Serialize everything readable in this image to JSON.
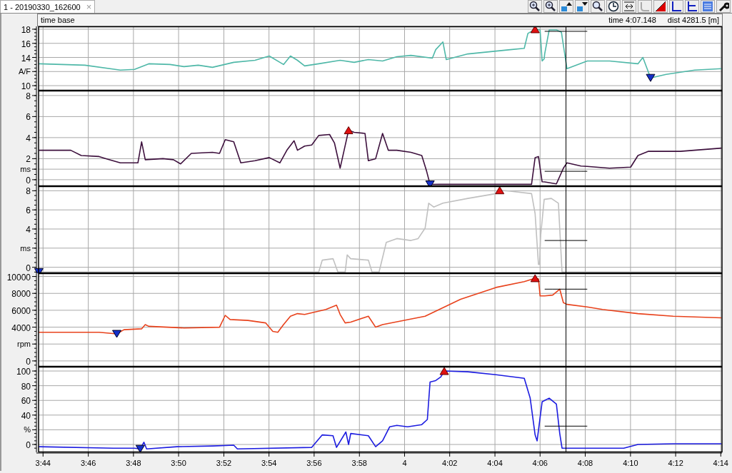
{
  "tab": {
    "label": "1 - 20190330_162600",
    "close": "×",
    "selected": true
  },
  "header": {
    "label": "time base",
    "time": "time 4:07.148",
    "dist": "dist 4281.5 [m]"
  },
  "charts": [
    {
      "chart_data": {
        "type": "line",
        "ylabel": "A/F",
        "xlim": [
          3.73,
          4.2342
        ],
        "ylim": [
          9.4,
          18.3
        ],
        "yticks": [
          10,
          14,
          16,
          18
        ],
        "grid": true,
        "x": [
          3.7302,
          3.7642,
          3.7903,
          3.8008,
          3.8113,
          3.827,
          3.8373,
          3.8478,
          3.8583,
          3.874,
          3.8897,
          3.9002,
          3.9107,
          3.9158,
          3.921,
          3.9263,
          3.9367,
          3.9525,
          3.9628,
          3.9733,
          3.9838,
          3.9943,
          4.0047,
          4.0205,
          4.023,
          4.0283,
          4.0308,
          4.0467,
          4.0623,
          4.078,
          4.0883,
          4.091,
          4.0963,
          4.1,
          4.1015,
          4.103,
          4.1034,
          4.1067,
          4.112,
          4.1157,
          4.1198,
          4.1348,
          4.1355,
          4.1512,
          4.1722,
          4.1758,
          4.1815,
          4.193,
          4.214,
          4.2338
        ],
        "series": [
          {
            "color": "#4fb8a8",
            "values": [
              13.1,
              12.9,
              12.2,
              12.3,
              13.1,
              13.0,
              12.7,
              12.9,
              12.6,
              13.3,
              13.6,
              14.2,
              13.0,
              14.2,
              13.6,
              12.8,
              13.1,
              13.6,
              13.3,
              13.7,
              13.5,
              14.1,
              14.3,
              13.9,
              15.1,
              16.2,
              13.7,
              14.5,
              14.8,
              15.1,
              15.3,
              17.4,
              18.0,
              17.9,
              13.5,
              13.8,
              14.5,
              17.9,
              17.9,
              17.6,
              12.4,
              13.5,
              13.5,
              13.5,
              13.1,
              14.0,
              11.1,
              11.6,
              12.2,
              12.4
            ]
          },
          {
            "color": "#000000",
            "values": [
              null,
              null,
              null,
              null,
              null,
              null,
              null,
              null,
              null,
              null,
              null,
              null,
              null,
              null,
              null,
              null,
              null,
              null,
              null,
              null,
              null,
              null,
              null,
              null,
              null,
              null,
              null,
              null,
              null,
              null,
              null,
              null,
              null,
              null,
              null,
              null,
              17.7,
              17.7,
              17.7,
              17.7,
              17.7,
              17.7,
              null,
              null,
              null,
              null,
              null,
              null,
              null,
              null
            ]
          }
        ],
        "ref_lines": [
          {
            "axis": "x",
            "value": 4.1191
          }
        ]
      }
    },
    {
      "chart_data": {
        "type": "line",
        "ylabel": "ms",
        "xlim": [
          3.73,
          4.2342
        ],
        "ylim": [
          -0.55,
          8.4
        ],
        "yticks": [
          0,
          2,
          4,
          6,
          8
        ],
        "grid": true,
        "x": [
          3.7302,
          3.7537,
          3.7615,
          3.7747,
          3.7798,
          3.7903,
          3.8033,
          3.806,
          3.8087,
          3.8217,
          3.8295,
          3.8348,
          3.8427,
          3.8583,
          3.8635,
          3.8677,
          3.874,
          3.8792,
          3.8897,
          3.9002,
          3.908,
          3.9132,
          3.9185,
          3.921,
          3.9263,
          3.9315,
          3.9367,
          3.9447,
          3.9483,
          3.9525,
          3.9587,
          3.9628,
          3.9708,
          3.9733,
          3.9787,
          3.9838,
          3.988,
          3.9943,
          4.0047,
          4.0127,
          4.0163,
          4.0188,
          4.0257,
          4.0675,
          4.0937,
          4.0963,
          4.0988,
          4.1015,
          4.1034,
          4.112,
          4.1172,
          4.1198,
          4.1302,
          4.1348,
          4.1512,
          4.1668,
          4.1722,
          4.18,
          4.2035,
          4.2338
        ],
        "series": [
          {
            "color": "#3d103d",
            "values": [
              2.8,
              2.8,
              2.3,
              2.2,
              2.0,
              1.6,
              1.6,
              3.6,
              1.9,
              2.0,
              1.9,
              1.5,
              2.5,
              2.6,
              2.5,
              3.8,
              3.6,
              1.6,
              1.8,
              2.1,
              1.6,
              2.8,
              3.7,
              2.8,
              3.2,
              3.3,
              4.2,
              4.3,
              3.5,
              1.1,
              4.7,
              4.5,
              4.4,
              1.8,
              2.0,
              4.4,
              2.8,
              2.8,
              2.6,
              2.3,
              0.8,
              -0.45,
              -0.44,
              -0.44,
              -0.44,
              2.1,
              2.2,
              -0.2,
              -0.21,
              -0.4,
              1.1,
              1.6,
              1.3,
              1.26,
              1.1,
              1.2,
              2.3,
              2.7,
              2.7,
              3.0
            ]
          },
          {
            "color": "#000000",
            "values": [
              null,
              null,
              null,
              null,
              null,
              null,
              null,
              null,
              null,
              null,
              null,
              null,
              null,
              null,
              null,
              null,
              null,
              null,
              null,
              null,
              null,
              null,
              null,
              null,
              null,
              null,
              null,
              null,
              null,
              null,
              null,
              null,
              null,
              null,
              null,
              null,
              null,
              null,
              null,
              null,
              null,
              null,
              null,
              null,
              null,
              null,
              null,
              null,
              0.8,
              0.8,
              0.8,
              0.8,
              0.8,
              0.8,
              null,
              null,
              null,
              null,
              null,
              null
            ]
          }
        ],
        "ref_lines": [
          {
            "axis": "x",
            "value": 4.1191
          }
        ]
      }
    },
    {
      "chart_data": {
        "type": "line",
        "ylabel": "ms",
        "xlim": [
          3.73,
          4.2342
        ],
        "ylim": [
          -0.55,
          8.4
        ],
        "yticks": [
          0,
          4,
          6,
          8
        ],
        "grid": true,
        "x": [
          3.7302,
          3.9367,
          3.9393,
          3.9472,
          3.9508,
          3.9562,
          3.9577,
          3.9603,
          3.9733,
          3.976,
          3.9812,
          3.9865,
          3.9943,
          4.0047,
          4.01,
          4.0152,
          4.0178,
          4.0215,
          4.0283,
          4.0467,
          4.0675,
          4.0702,
          4.078,
          4.0937,
          4.0963,
          4.0988,
          4.0996,
          4.1005,
          4.103,
          4.1034,
          4.1083,
          4.1135,
          4.1162,
          4.1348,
          4.2338
        ],
        "series": [
          {
            "color": "#c0c0c0",
            "values": [
              -0.5,
              -0.5,
              0.75,
              0.9,
              -0.5,
              -0.5,
              1.3,
              0.9,
              0.75,
              -0.5,
              -0.5,
              2.6,
              3.0,
              2.8,
              3.0,
              4.1,
              6.7,
              6.3,
              6.7,
              7.2,
              7.7,
              8.05,
              7.95,
              7.7,
              5.6,
              0.3,
              0.3,
              3.4,
              7.1,
              7.1,
              7.2,
              6.7,
              -0.5,
              -0.5,
              -0.5
            ]
          },
          {
            "color": "#000000",
            "values": [
              null,
              null,
              null,
              null,
              null,
              null,
              null,
              null,
              null,
              null,
              null,
              null,
              null,
              null,
              null,
              null,
              null,
              null,
              null,
              null,
              null,
              null,
              null,
              null,
              null,
              null,
              null,
              null,
              null,
              2.8,
              2.8,
              2.8,
              2.8,
              2.8,
              null
            ]
          }
        ],
        "ref_lines": [
          {
            "axis": "x",
            "value": 4.1191
          }
        ]
      }
    },
    {
      "chart_data": {
        "type": "line",
        "ylabel": "rpm",
        "xlim": [
          3.73,
          4.2342
        ],
        "ylim": [
          -600,
          10300
        ],
        "yticks": [
          0,
          4000,
          6000,
          8000,
          10000
        ],
        "grid": true,
        "x": [
          3.7302,
          3.7747,
          3.7877,
          3.793,
          3.806,
          3.8087,
          3.8113,
          3.8373,
          3.8635,
          3.8677,
          3.8713,
          3.8845,
          3.8975,
          3.9028,
          3.9065,
          3.9107,
          3.9158,
          3.921,
          3.9263,
          3.942,
          3.9498,
          3.9525,
          3.9562,
          3.9603,
          3.9733,
          3.9787,
          3.9838,
          4.0152,
          4.0413,
          4.0675,
          4.0883,
          4.0963,
          4.0988,
          4.1,
          4.1034,
          4.1093,
          4.1145,
          4.1172,
          4.1198,
          4.1348,
          4.146,
          4.1722,
          4.1982,
          4.2338
        ],
        "series": [
          {
            "color": "#e8421c",
            "values": [
              3400,
              3400,
              3200,
              3700,
              3800,
              4300,
              4100,
              3900,
              4000,
              5400,
              4900,
              4800,
              4500,
              3500,
              3400,
              4300,
              5300,
              5600,
              5500,
              6100,
              6600,
              5500,
              4500,
              4600,
              5300,
              4000,
              4300,
              5300,
              7300,
              8700,
              9400,
              9800,
              9700,
              7700,
              7700,
              7800,
              8500,
              6900,
              6700,
              6400,
              6100,
              5600,
              5300,
              5100
            ]
          },
          {
            "color": "#000000",
            "values": [
              null,
              null,
              null,
              null,
              null,
              null,
              null,
              null,
              null,
              null,
              null,
              null,
              null,
              null,
              null,
              null,
              null,
              null,
              null,
              null,
              null,
              null,
              null,
              null,
              null,
              null,
              null,
              null,
              null,
              null,
              null,
              null,
              null,
              null,
              8500,
              8500,
              8500,
              8500,
              8500,
              8500,
              null,
              null,
              null,
              null
            ]
          }
        ],
        "ref_lines": [
          {
            "axis": "x",
            "value": 4.1191
          }
        ]
      }
    },
    {
      "chart_data": {
        "type": "line",
        "ylabel": "%",
        "xlim": [
          3.73,
          4.2342
        ],
        "ylim": [
          -9.7,
          104.9
        ],
        "yticks": [
          0,
          40,
          60,
          80,
          100
        ],
        "grid": true,
        "xticks": [
          {
            "value": 3.7333,
            "label": "3:44"
          },
          {
            "value": 3.7667,
            "label": "3:46"
          },
          {
            "value": 3.8,
            "label": "3:48"
          },
          {
            "value": 3.8333,
            "label": "3:50"
          },
          {
            "value": 3.8667,
            "label": "3:52"
          },
          {
            "value": 3.9,
            "label": "3:54"
          },
          {
            "value": 3.9333,
            "label": "3:56"
          },
          {
            "value": 3.9667,
            "label": "3:58"
          },
          {
            "value": 4,
            "label": "4"
          },
          {
            "value": 4.0333,
            "label": "4:02"
          },
          {
            "value": 4.0667,
            "label": "4:04"
          },
          {
            "value": 4.1,
            "label": "4:06"
          },
          {
            "value": 4.1333,
            "label": "4:08"
          },
          {
            "value": 4.1667,
            "label": "4:10"
          },
          {
            "value": 4.2,
            "label": "4:12"
          },
          {
            "value": 4.2333,
            "label": "4:14"
          }
        ],
        "x": [
          3.7302,
          3.7852,
          3.8008,
          3.805,
          3.8077,
          3.8097,
          3.8322,
          3.8583,
          3.874,
          3.8767,
          3.9315,
          3.9393,
          3.9472,
          3.9498,
          3.9567,
          3.9587,
          3.9603,
          3.9733,
          3.9787,
          3.9838,
          3.989,
          3.9943,
          4.0022,
          4.0127,
          4.0168,
          4.0188,
          4.023,
          4.0267,
          4.0293,
          4.0467,
          4.0675,
          4.0883,
          4.0927,
          4.0963,
          4.0978,
          4.1015,
          4.1034,
          4.1067,
          4.112,
          4.1145,
          4.1162,
          4.1348,
          4.1617,
          4.1722,
          4.1982,
          4.2338
        ],
        "series": [
          {
            "color": "#1c1ce0",
            "values": [
              -3,
              -5,
              -5,
              -6,
              3,
              -6,
              -3,
              -2,
              -1,
              -6,
              -4,
              13,
              12,
              -4,
              17,
              0,
              15,
              12,
              -3,
              5,
              24,
              26,
              24,
              27,
              34,
              85,
              87,
              92,
              100,
              99,
              95,
              90,
              63,
              13,
              5,
              58,
              60,
              63,
              55,
              15,
              -5,
              -5,
              -5,
              0,
              1,
              1
            ]
          },
          {
            "color": "#000000",
            "values": [
              null,
              null,
              null,
              null,
              null,
              null,
              null,
              null,
              null,
              null,
              null,
              null,
              null,
              null,
              null,
              null,
              null,
              null,
              null,
              null,
              null,
              null,
              null,
              null,
              null,
              null,
              null,
              null,
              null,
              null,
              null,
              null,
              null,
              null,
              null,
              null,
              25,
              25,
              25,
              25,
              25,
              25,
              null,
              null,
              null,
              null
            ]
          }
        ],
        "ref_lines": [
          {
            "axis": "x",
            "value": 4.1191
          }
        ]
      }
    }
  ]
}
